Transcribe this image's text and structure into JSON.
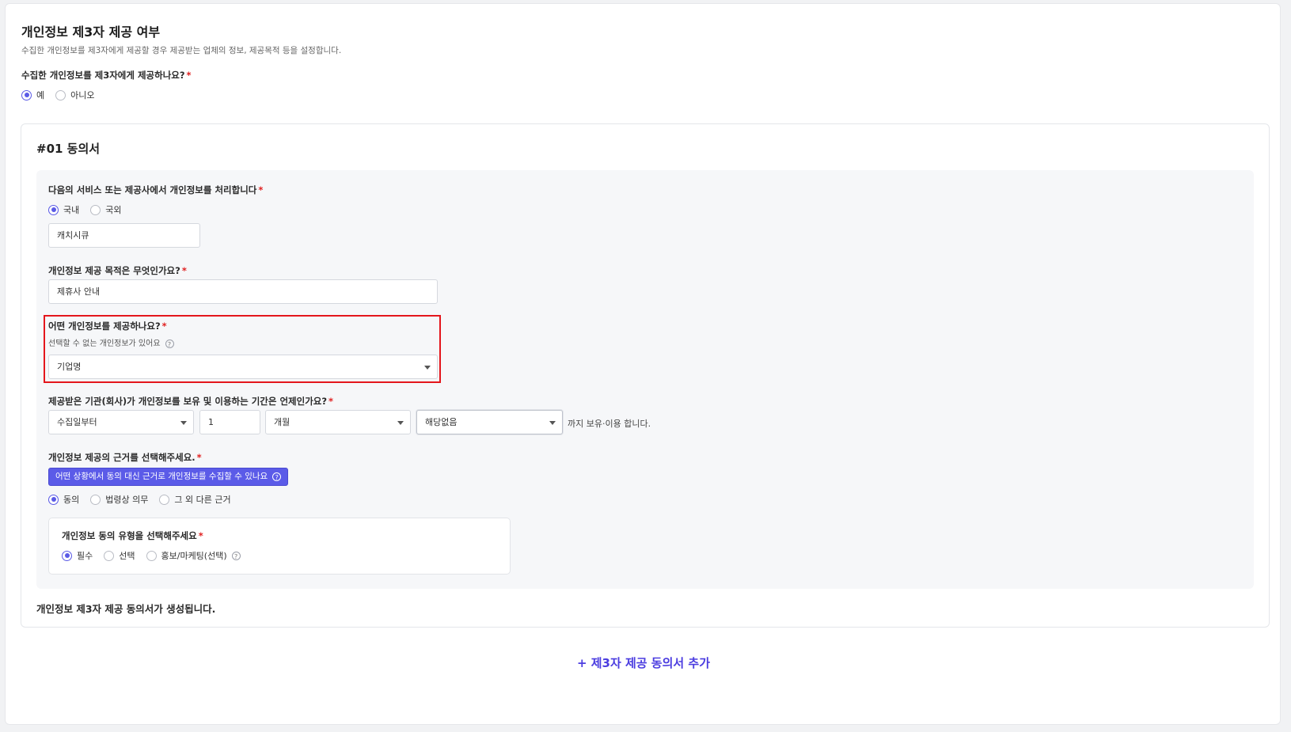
{
  "section": {
    "title": "개인정보 제3자 제공 여부",
    "subtitle": "수집한 개인정보를 제3자에게 제공할 경우 제공받는 업체의 정보, 제공목적 등을 설정합니다.",
    "question": "수집한 개인정보를 제3자에게 제공하나요?",
    "options": [
      "예",
      "아니오"
    ],
    "selected": "예"
  },
  "consent": {
    "title": "#01 동의서",
    "processor": {
      "question": "다음의 서비스 또는 제공사에서 개인정보를 처리합니다",
      "options": [
        "국내",
        "국외"
      ],
      "selected": "국내",
      "value": "캐치시큐"
    },
    "purpose": {
      "question": "개인정보 제공 목적은 무엇인가요?",
      "value": "제휴사 안내"
    },
    "items": {
      "question": "어떤 개인정보를 제공하나요?",
      "hint": "선택할 수 없는 개인정보가 있어요",
      "value": "기업명"
    },
    "retention": {
      "question": "제공받은 기관(회사)가 개인정보를 보유 및 이용하는 기간은 언제인가요?",
      "start": "수집일부터",
      "amount": "1",
      "unit": "개월",
      "until": "해당없음",
      "suffix": "까지 보유·이용 합니다."
    },
    "basis": {
      "question": "개인정보 제공의 근거를 선택해주세요.",
      "info_button": "어떤 상황에서 동의 대신 근거로 개인정보를 수집할 수 있나요",
      "options": [
        "동의",
        "법령상 의무",
        "그 외 다른 근거"
      ],
      "selected": "동의"
    },
    "consent_type": {
      "question": "개인정보 동의 유형을 선택해주세요",
      "options": [
        "필수",
        "선택",
        "홍보/마케팅(선택)"
      ],
      "selected": "필수"
    },
    "footer": "개인정보 제3자 제공 동의서가 생성됩니다."
  },
  "add_button": "+ 제3자 제공 동의서 추가",
  "icons": {
    "help": "question-circle-icon",
    "caret": "caret-down-icon"
  },
  "colors": {
    "accent": "#5a5ae6",
    "highlight": "#e4161c",
    "link": "#4b3de0"
  }
}
